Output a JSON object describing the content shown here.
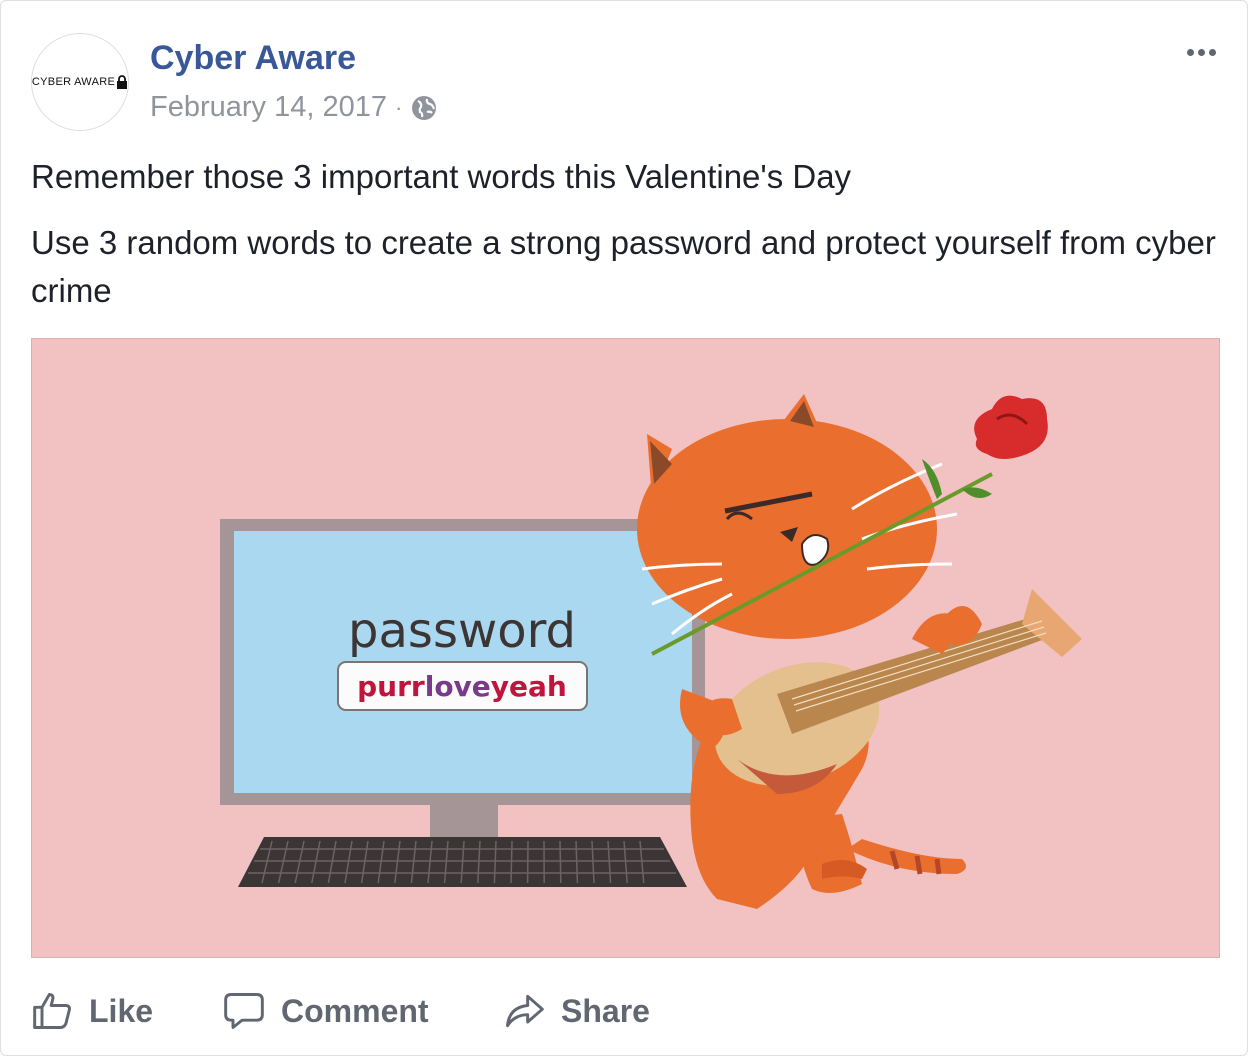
{
  "post": {
    "page_name": "Cyber Aware",
    "avatar_logo_text": "CYBER AWARE",
    "date": "February 14, 2017",
    "separator": "·",
    "audience_icon": "globe-icon",
    "more_icon": "more-options-icon",
    "text_line_1": "Remember those 3 important words this Valentine's Day",
    "text_line_2": "Use 3 random words to create a strong password and protect yourself from cyber crime"
  },
  "image": {
    "screen_word": "password",
    "password_parts": [
      "purr",
      "love",
      "yeah"
    ],
    "colors": {
      "background": "#f2c2c3",
      "screen": "#a9d8f0",
      "monitor_frame": "#a59596",
      "cat": "#ea6f2f",
      "purr": "#c0143c",
      "love": "#7a3a8a",
      "yeah": "#c0143c"
    }
  },
  "actions": {
    "like_label": "Like",
    "comment_label": "Comment",
    "share_label": "Share"
  },
  "colors": {
    "page_name": "#385898",
    "meta": "#90949c",
    "body_text": "#1d2129",
    "action_text": "#606770"
  }
}
